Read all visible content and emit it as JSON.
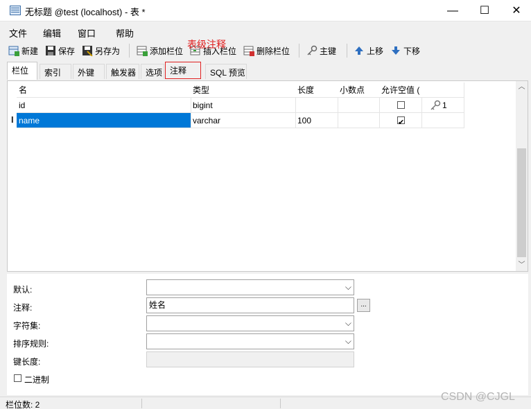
{
  "window": {
    "title": "无标题 @test (localhost) - 表 *",
    "minimize": "—",
    "maximize": "☐",
    "close": "✕"
  },
  "menu": [
    "文件",
    "编辑",
    "窗口",
    "帮助"
  ],
  "toolbar": {
    "new": "新建",
    "save": "保存",
    "save_as": "另存为",
    "add_field": "添加栏位",
    "insert_field": "插入栏位",
    "delete_field": "删除栏位",
    "primary_key": "主键",
    "move_up": "上移",
    "move_down": "下移"
  },
  "annotation": "表级注释",
  "tabs": [
    "栏位",
    "索引",
    "外键",
    "触发器",
    "选项",
    "注释",
    "SQL 预览"
  ],
  "grid": {
    "columns": [
      "名",
      "类型",
      "长度",
      "小数点",
      "允许空值 ("
    ],
    "rows": [
      {
        "name": "id",
        "type": "bigint",
        "length": "",
        "decimals": "",
        "nullable": false,
        "key": "1"
      },
      {
        "name": "name",
        "type": "varchar",
        "length": "100",
        "decimals": "",
        "nullable": true,
        "key": ""
      }
    ]
  },
  "properties": {
    "default_label": "默认:",
    "comment_label": "注释:",
    "comment_value": "姓名",
    "comment_button": "...",
    "charset_label": "字符集:",
    "collation_label": "排序规则:",
    "key_length_label": "键长度:",
    "binary_label": "二进制"
  },
  "status": {
    "field_count": "栏位数: 2"
  },
  "watermark": "CSDN @CJGL",
  "colors": {
    "selection": "#0078d7",
    "annotation": "#e02020"
  }
}
